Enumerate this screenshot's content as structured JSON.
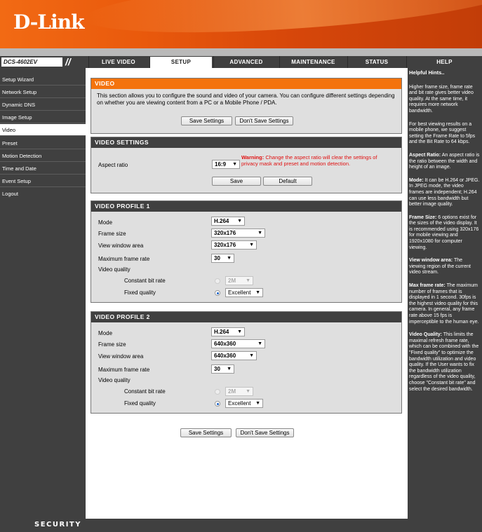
{
  "brand": {
    "logo": "D-Link",
    "model": "DCS-4602EV",
    "footer": "SECURITY"
  },
  "nav": {
    "tabs": [
      {
        "label": "LIVE VIDEO"
      },
      {
        "label": "SETUP"
      },
      {
        "label": "ADVANCED"
      },
      {
        "label": "MAINTENANCE"
      },
      {
        "label": "STATUS"
      },
      {
        "label": "HELP"
      }
    ]
  },
  "sidebar": {
    "items": [
      {
        "label": "Setup Wizard"
      },
      {
        "label": "Network Setup"
      },
      {
        "label": "Dynamic DNS"
      },
      {
        "label": "Image Setup"
      },
      {
        "label": "Video"
      },
      {
        "label": "Preset"
      },
      {
        "label": "Motion Detection"
      },
      {
        "label": "Time and Date"
      },
      {
        "label": "Event Setup"
      },
      {
        "label": "Logout"
      }
    ]
  },
  "video": {
    "title": "VIDEO",
    "description": "This section allows you to configure the sound and video of your camera. You can configure different settings depending on whether you are viewing content from a PC or a Mobile Phone / PDA.",
    "save_label": "Save Settings",
    "dont_save_label": "Don't Save Settings"
  },
  "video_settings": {
    "title": "VIDEO SETTINGS",
    "aspect_label": "Aspect ratio",
    "aspect_value": "16:9",
    "warning_bold": "Warning:",
    "warning_text": "Change the aspect ratio will clear the settings of privacy mask and preset and motion detection.",
    "save_label": "Save",
    "default_label": "Default"
  },
  "profile1": {
    "title": "VIDEO PROFILE 1",
    "mode_label": "Mode",
    "mode": "H.264",
    "frame_label": "Frame size",
    "frame": "320x176",
    "view_label": "View window area",
    "view": "320x176",
    "rate_label": "Maximum frame rate",
    "rate": "30",
    "quality_label": "Video quality",
    "cbr_label": "Constant bit rate",
    "cbr": "2M",
    "fixed_label": "Fixed quality",
    "fixed": "Excellent"
  },
  "profile2": {
    "title": "VIDEO PROFILE 2",
    "mode_label": "Mode",
    "mode": "H.264",
    "frame_label": "Frame size",
    "frame": "640x360",
    "view_label": "View window area",
    "view": "640x360",
    "rate_label": "Maximum frame rate",
    "rate": "30",
    "quality_label": "Video quality",
    "cbr_label": "Constant bit rate",
    "cbr": "2M",
    "fixed_label": "Fixed quality",
    "fixed": "Excellent"
  },
  "bottom": {
    "save_label": "Save Settings",
    "dont_save_label": "Don't Save Settings"
  },
  "help": {
    "heading": "Helpful Hints..",
    "p1": "Higher frame size, frame rate and bit rate gives better video quality. At the same time, it requires more network bandwidth.",
    "p2": "For best viewing results on a mobile phone, we suggest setting the Frame Rate to 5fps and the Bit Rate to 64 kbps.",
    "p3_bold": "Aspect Ratio:",
    "p3": "An aspect ratio is the ratio between the width and height of an image.",
    "p4_bold": "Mode:",
    "p4": "It can be H.264 or JPEG. In JPEG mode, the video frames are independent; H.264 can use less bandwidth but better image quality.",
    "p5_bold": "Frame Size:",
    "p5": "6 options exist for the sizes of the video display. It is recommended using 320x176 for mobile viewing and 1920x1080 for computer viewing.",
    "p6_bold": "View window area:",
    "p6": "The viewing region of the current video stream.",
    "p7_bold": "Max frame rate:",
    "p7": "The maximum number of frames that is displayed in 1 second. 30fps is the highest video quality for this camera. In general, any frame rate above 15 fps is imperceptible to the human eye.",
    "p8_bold": "Video Quality:",
    "p8": "This limits the maximal refresh frame rate, which can be combined with the \"Fixed quality\" to optimize the bandwidth utilization and video quality. If the User wants to fix the bandwidth utilization regardless of the video quality, choose \"Constant bit rate\" and select the desired bandwidth."
  }
}
